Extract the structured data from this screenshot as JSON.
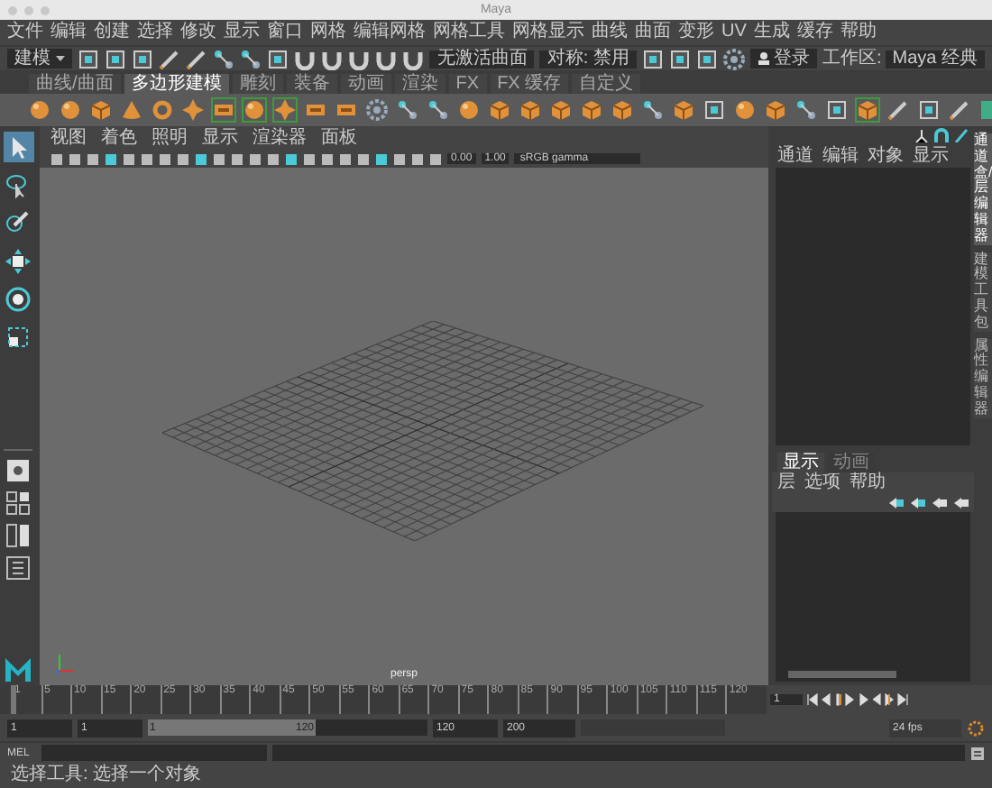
{
  "window": {
    "title": "Maya"
  },
  "menu_bar": [
    "文件",
    "编辑",
    "创建",
    "选择",
    "修改",
    "显示",
    "窗口",
    "网格",
    "编辑网格",
    "网格工具",
    "网格显示",
    "曲线",
    "曲面",
    "变形",
    "UV",
    "生成",
    "缓存",
    "帮助"
  ],
  "status_line": {
    "mode": "建模",
    "surface": "无激活曲面",
    "symmetry": "对称: 禁用",
    "login": "登录",
    "workspace_label": "工作区:",
    "workspace": "Maya 经典"
  },
  "shelf": {
    "tabs": [
      {
        "label": "曲线/曲面",
        "selected": false
      },
      {
        "label": "多边形建模",
        "selected": true
      },
      {
        "label": "雕刻",
        "selected": false
      },
      {
        "label": "装备",
        "selected": false
      },
      {
        "label": "动画",
        "selected": false
      },
      {
        "label": "渲染",
        "selected": false
      },
      {
        "label": "FX",
        "selected": false
      },
      {
        "label": "FX 缓存",
        "selected": false
      },
      {
        "label": "自定义",
        "selected": false
      }
    ]
  },
  "tools": [
    {
      "kind": "select",
      "selected": true
    },
    {
      "kind": "lasso",
      "selected": false
    },
    {
      "kind": "paint",
      "selected": false
    },
    {
      "kind": "move",
      "selected": false
    },
    {
      "kind": "rotate",
      "selected": false
    },
    {
      "kind": "scale",
      "selected": false
    }
  ],
  "viewport": {
    "menu": [
      "视图",
      "着色",
      "照明",
      "显示",
      "渲染器",
      "面板"
    ],
    "exposure": "0.00",
    "gamma": "1.00",
    "color_space": "sRGB gamma",
    "camera": "persp"
  },
  "channel_box": {
    "menu": [
      "通道",
      "编辑",
      "对象",
      "显示"
    ]
  },
  "side_tabs": [
    {
      "label": "通道盒/层编辑器",
      "selected": true
    },
    {
      "label": "建模工具包",
      "selected": false
    },
    {
      "label": "属性编辑器",
      "selected": false
    }
  ],
  "layer_editor": {
    "tabs": [
      {
        "label": "显示",
        "selected": true
      },
      {
        "label": "动画",
        "selected": false
      }
    ],
    "menu": [
      "层",
      "选项",
      "帮助"
    ]
  },
  "time_slider": {
    "ticks": [
      "1",
      "5",
      "10",
      "15",
      "20",
      "25",
      "30",
      "35",
      "40",
      "45",
      "50",
      "55",
      "60",
      "65",
      "70",
      "75",
      "80",
      "85",
      "90",
      "95",
      "100",
      "105",
      "110",
      "115",
      "120"
    ],
    "current_frame": "1",
    "level": 0
  },
  "range": {
    "start": "1",
    "playback_start": "1",
    "slider_start": "1",
    "slider_end": "120",
    "level": 0.6,
    "playback_end": "120",
    "end": "200",
    "fps": "24 fps"
  },
  "command_line": {
    "language": "MEL"
  },
  "help_line": "选择工具: 选择一个对象"
}
